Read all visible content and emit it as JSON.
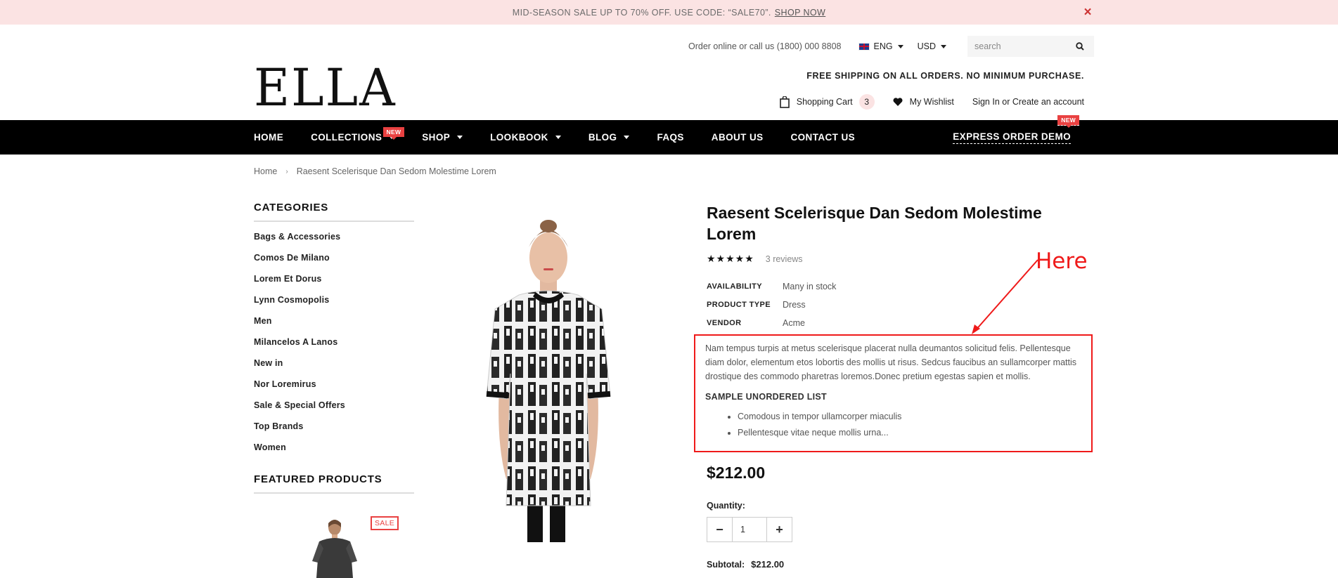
{
  "promo": {
    "text": "MID-SEASON SALE UP TO 70% OFF. USE CODE: “SALE70”.",
    "link": "SHOP NOW",
    "close": "×"
  },
  "topbar": {
    "phone": "Order online or call us (1800) 000 8808",
    "language": "ENG",
    "currency": "USD",
    "search_placeholder": "search"
  },
  "logo": "ELLA",
  "shipping": "FREE SHIPPING ON ALL ORDERS. NO MINIMUM PURCHASE.",
  "account": {
    "cart_label": "Shopping Cart",
    "cart_count": "3",
    "wishlist": "My Wishlist",
    "sign_in": "Sign In",
    "or": " or ",
    "create": "Create an account"
  },
  "nav": {
    "items": [
      "HOME",
      "COLLECTIONS",
      "SHOP",
      "LOOKBOOK",
      "BLOG",
      "FAQS",
      "ABOUT US",
      "CONTACT US"
    ],
    "badge": "NEW",
    "express": "EXPRESS ORDER DEMO"
  },
  "breadcrumb": {
    "home": "Home",
    "current": "Raesent Scelerisque Dan Sedom Molestime Lorem"
  },
  "sidebar": {
    "categories_title": "CATEGORIES",
    "categories": [
      "Bags & Accessories",
      "Comos De Milano",
      "Lorem Et Dorus",
      "Lynn Cosmopolis",
      "Men",
      "Milancelos A Lanos",
      "New in",
      "Nor Loremirus",
      "Sale & Special Offers",
      "Top Brands",
      "Women"
    ],
    "featured_title": "FEATURED PRODUCTS",
    "sale_badge": "SALE"
  },
  "product": {
    "title": "Raesent Scelerisque Dan Sedom Molestime Lorem",
    "stars": "★★★★★",
    "reviews": "3 reviews",
    "specs": [
      {
        "k": "AVAILABILITY",
        "v": "Many in stock"
      },
      {
        "k": "PRODUCT TYPE",
        "v": "Dress"
      },
      {
        "k": "VENDOR",
        "v": "Acme"
      }
    ],
    "description": "Nam tempus turpis at metus scelerisque placerat nulla deumantos solicitud felis. Pellentesque diam dolor, elementum etos lobortis des mollis ut risus. Sedcus faucibus an sullamcorper mattis drostique des commodo pharetras loremos.Donec pretium egestas sapien et mollis.",
    "list_title": "SAMPLE UNORDERED LIST",
    "list": [
      "Comodous in tempor ullamcorper miaculis",
      "Pellentesque vitae neque mollis urna..."
    ],
    "price": "$212.00",
    "quantity_label": "Quantity:",
    "quantity": "1",
    "subtotal_label": "Subtotal:",
    "subtotal": "$212.00"
  },
  "annotation": {
    "text": "Here",
    "color": "#ef1a1a"
  }
}
